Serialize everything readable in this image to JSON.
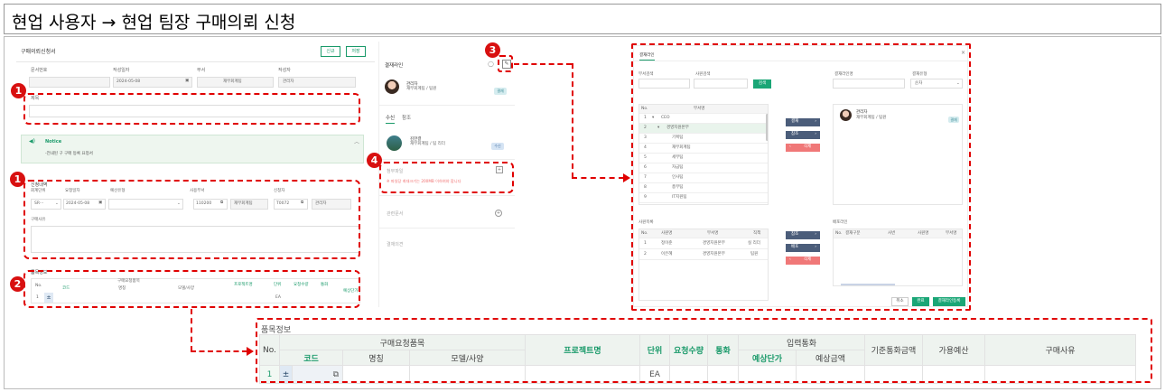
{
  "page_title": "현업 사용자 → 현업 팀장 구매의뢰 신청",
  "badges": {
    "b1a": "1",
    "b1b": "1",
    "b2": "2",
    "b3": "3",
    "b4": "4"
  },
  "form": {
    "title": "구매의뢰신청서",
    "btn_new": "신규",
    "btn_save": "저장",
    "doc_no_label": "문서번호",
    "date_label": "작성일자",
    "date_value": "2024-05-08",
    "dept_label": "부서",
    "dept_value": "재무회계팀",
    "writer_label": "작성자",
    "writer_value": "관리자",
    "subject_label": "제목",
    "notice_title": "Notice",
    "notice_text": "-전내된 구 구매 등록 요청서",
    "req_section": "신청내역",
    "company_label": "회계단위",
    "company_value": "SR···",
    "req_date_label": "요청일자",
    "req_date_value": "2024-05-08",
    "budget_label": "예산유형",
    "use_dept_label": "사용부서",
    "use_dept_code": "110200",
    "use_dept_name": "재무회계팀",
    "requester_label": "신청자",
    "requester_code": "T0072",
    "requester_name": "관리자",
    "reason_label": "구매사유",
    "items_section": "품목정보",
    "items_group": "구매요청품목",
    "col_no": "No.",
    "col_code": "코드",
    "col_name": "명칭",
    "col_model": "모델/사양",
    "col_project": "프로젝트명",
    "col_unit": "단위",
    "col_qty": "요청수량",
    "col_cur": "통화",
    "col_price": "예상단가",
    "row_no": "1",
    "row_unit": "EA"
  },
  "approval": {
    "title": "결재라인",
    "approver_name": "관리자",
    "approver_dept": "재무회계팀 / 팀원",
    "approver_badge": "결재",
    "tab_receive": "수신",
    "tab_ref": "참조",
    "receiver_name": "김한결",
    "receiver_dept": "재무회계팀 / 팀 리더",
    "receiver_badge": "수신",
    "attach_label": "첨부파일",
    "attach_warn": "※ 파일당 최대크기는 200MB 이하여야 합니다",
    "related_label": "관련문서",
    "opinion_label": "결재의견"
  },
  "dialog": {
    "title": "결재라인",
    "close": "×",
    "dept_search_label": "부서검색",
    "user_search_label": "사원검색",
    "search_btn": "검색",
    "line_name_label": "결재라인명",
    "line_type_label": "결재유형",
    "line_type_value": "순차",
    "tree_col_no": "No.",
    "tree_col_dept": "부서명",
    "tree": [
      {
        "no": "1",
        "name": "CEO"
      },
      {
        "no": "2",
        "name": "경영지원본부"
      },
      {
        "no": "3",
        "name": "기획팀"
      },
      {
        "no": "4",
        "name": "재무회계팀"
      },
      {
        "no": "5",
        "name": "세무팀"
      },
      {
        "no": "6",
        "name": "자금팀"
      },
      {
        "no": "7",
        "name": "인사팀"
      },
      {
        "no": "8",
        "name": "총무팀"
      },
      {
        "no": "9",
        "name": "IT지원팀"
      }
    ],
    "btn_approve": "결재",
    "btn_ref": "참조",
    "btn_delete": "삭제",
    "selected_name": "관리자",
    "selected_dept": "재무회계팀 / 팀원",
    "selected_badge": "결재",
    "user_list_label": "사원목록",
    "user_cols": [
      "No.",
      "사원명",
      "부서명",
      "직책"
    ],
    "users": [
      {
        "no": "1",
        "name": "정이준",
        "dept": "경영지원본부",
        "pos": "실 리더"
      },
      {
        "no": "2",
        "name": "이은혜",
        "dept": "경영지원본부",
        "pos": "팀원"
      }
    ],
    "btn_ref2": "참조",
    "btn_receive2": "배포",
    "btn_delete2": "삭제",
    "dist_label": "배포라인",
    "dist_cols": [
      "No.",
      "결재구분",
      "사번",
      "사원명",
      "부서명"
    ],
    "btn_cancel": "취소",
    "btn_confirm": "완료",
    "btn_register": "결재라인등록"
  },
  "zoom": {
    "section": "품목정보",
    "col_no": "No.",
    "group_items": "구매요청품목",
    "col_code": "코드",
    "col_name": "명칭",
    "col_model": "모델/사양",
    "col_project": "프로젝트명",
    "col_unit": "단위",
    "col_qty": "요청수량",
    "col_cur": "통화",
    "group_input": "입력통화",
    "col_price": "예상단가",
    "col_amount": "예상금액",
    "col_base_amount": "기준통화금액",
    "col_budget": "가용예산",
    "col_reason": "구매사유",
    "row_no": "1",
    "row_unit": "EA"
  }
}
